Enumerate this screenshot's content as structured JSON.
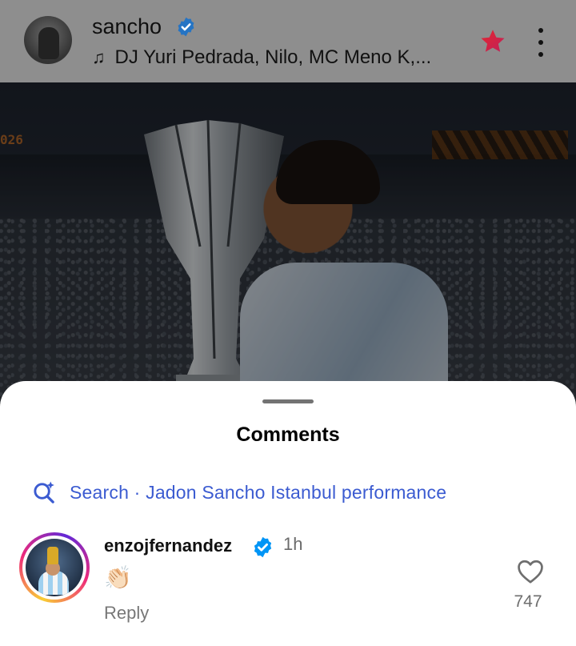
{
  "post": {
    "username": "sancho",
    "music": "DJ Yuri Pedrada, Nilo, MC Meno K,...",
    "photo_text": {
      "score": "026"
    }
  },
  "comments_sheet": {
    "title": "Comments",
    "search_suggestion": "Search · Jadon Sancho Istanbul performance",
    "comments": [
      {
        "username": "enzojfernandez",
        "time": "1h",
        "body": "👏🏻",
        "reply_label": "Reply",
        "likes": "747"
      }
    ]
  },
  "colors": {
    "accent_link": "#3b5bd1",
    "verified": "#0095f6",
    "star": "#e4262f"
  },
  "icons": [
    "music-note-icon",
    "verified-badge-icon",
    "star-icon",
    "more-vertical-icon",
    "search-sparkle-icon",
    "heart-outline-icon"
  ]
}
